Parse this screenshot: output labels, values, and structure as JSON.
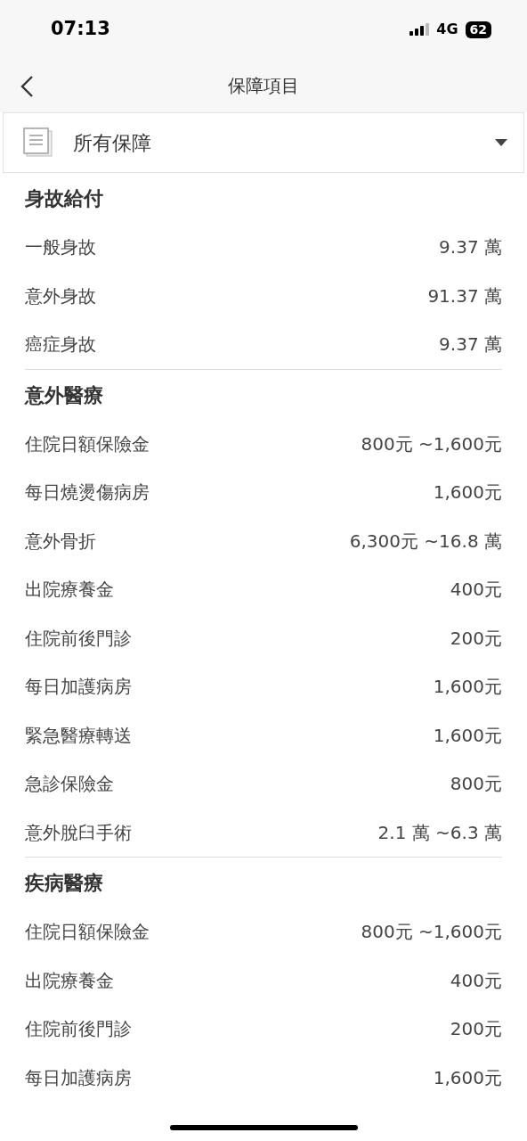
{
  "status_bar": {
    "time": "07:13",
    "network": "4G",
    "battery": "62"
  },
  "nav": {
    "title": "保障項目"
  },
  "filter": {
    "label": "所有保障"
  },
  "sections": [
    {
      "title": "身故給付",
      "items": [
        {
          "label": "一般身故",
          "value": "9.37 萬"
        },
        {
          "label": "意外身故",
          "value": "91.37 萬"
        },
        {
          "label": "癌症身故",
          "value": "9.37 萬"
        }
      ]
    },
    {
      "title": "意外醫療",
      "items": [
        {
          "label": "住院日額保險金",
          "value": "800元 ~1,600元"
        },
        {
          "label": "每日燒燙傷病房",
          "value": "1,600元"
        },
        {
          "label": "意外骨折",
          "value": "6,300元 ~16.8 萬"
        },
        {
          "label": "出院療養金",
          "value": "400元"
        },
        {
          "label": "住院前後門診",
          "value": "200元"
        },
        {
          "label": "每日加護病房",
          "value": "1,600元"
        },
        {
          "label": "緊急醫療轉送",
          "value": "1,600元"
        },
        {
          "label": "急診保險金",
          "value": "800元"
        },
        {
          "label": "意外脫臼手術",
          "value": "2.1 萬 ~6.3 萬"
        }
      ]
    },
    {
      "title": "疾病醫療",
      "items": [
        {
          "label": "住院日額保險金",
          "value": "800元 ~1,600元"
        },
        {
          "label": "出院療養金",
          "value": "400元"
        },
        {
          "label": "住院前後門診",
          "value": "200元"
        },
        {
          "label": "每日加護病房",
          "value": "1,600元"
        }
      ]
    }
  ]
}
